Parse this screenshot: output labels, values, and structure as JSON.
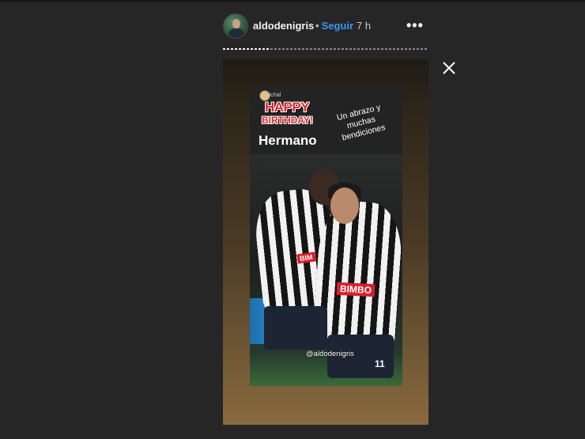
{
  "header": {
    "username": "aldodenigris",
    "separator": "•",
    "follow_label": "Seguir",
    "time_ago": "7 h",
    "more_label": "•••"
  },
  "progress": {
    "segments": 1,
    "fraction": 0.23
  },
  "story": {
    "badge_tag": "pichal",
    "happy_text": "HAPPY",
    "birthday_text": "BIRTHDAY!",
    "title": "Hermano",
    "message": "Un abrazo y muchas bendiciones",
    "mention": "@aldodenigris",
    "sponsor_text": "BIMBO",
    "sponsor_text_2": "BIM",
    "shirt_number": "11"
  },
  "icons": {
    "close": "close-icon",
    "more": "more-icon"
  },
  "colors": {
    "background": "#262626",
    "link_blue": "#3897f0",
    "text": "#f2f2f2"
  }
}
